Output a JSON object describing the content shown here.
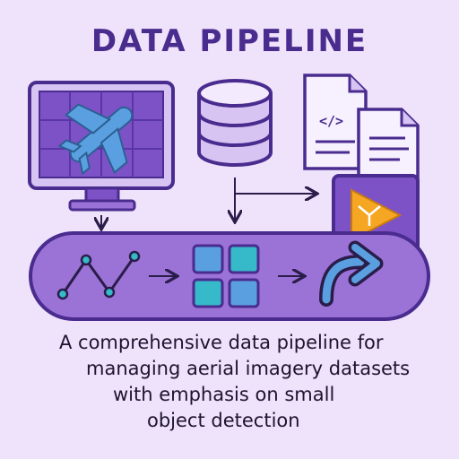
{
  "title": "DATA PIPELINE",
  "caption_lines": [
    "A comprehensive data pipeline for",
    "managing aerial imagery datasets",
    "with emphasis on small",
    "object detection"
  ],
  "icons": {
    "monitor": "monitor-airplane-icon",
    "database": "database-icon",
    "docs": "code-document-icon",
    "play": "video-play-icon",
    "chart": "line-chart-icon",
    "grid": "grid-icon",
    "curve": "curved-arrow-icon"
  },
  "colors": {
    "background": "#efe2fb",
    "title": "#4a2c8f",
    "outline": "#4a2c8f",
    "purple_fill": "#9b72d6",
    "light_purple": "#d7c4f3",
    "blue": "#5aa0e0",
    "teal": "#36b9c9",
    "orange": "#f5a623"
  }
}
